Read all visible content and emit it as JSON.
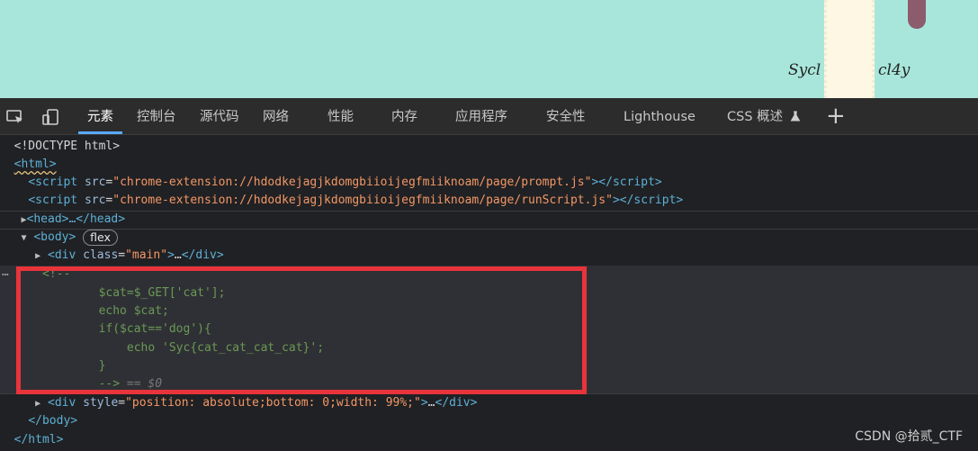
{
  "page": {
    "brand_left": "Sycl",
    "brand_right": "cl4y"
  },
  "devtools": {
    "tool_icons": [
      "inspect-element-icon",
      "device-toolbar-icon"
    ],
    "tabs": [
      {
        "label": "元素",
        "active": true
      },
      {
        "label": "控制台"
      },
      {
        "label": "源代码"
      },
      {
        "label": "网络"
      },
      {
        "label": "性能"
      },
      {
        "label": "内存"
      },
      {
        "label": "应用程序"
      },
      {
        "label": "安全性"
      },
      {
        "label": "Lighthouse"
      },
      {
        "label": "CSS 概述"
      }
    ],
    "css_overview_icon": "flask-icon",
    "add_tab": "+"
  },
  "dom": {
    "doctype": "<!DOCTYPE html>",
    "html_open": "<html>",
    "script1_tag": "script",
    "script1_attr": "src",
    "script1_value": "\"chrome-extension://hdodkejagjkdomgbiioijegfmiiknoam/page/prompt.js\"",
    "script2_value": "\"chrome-extension://hdodkejagjkdomgbiioijegfmiiknoam/page/runScript.js\"",
    "head": "<head>…</head>",
    "body_open": "<body>",
    "flex_badge": "flex",
    "div_main_class": "\"main\"",
    "ellipsis": "…",
    "comment_open": "<!--",
    "comment_lines": [
      "$cat=$_GET['cat'];",
      "echo $cat;",
      "if($cat=='dog'){",
      "echo 'Syc{cat_cat_cat_cat}';",
      "}"
    ],
    "comment_close": "-->",
    "comment_marker": " == $0",
    "div_style_value": "\"position: absolute;bottom: 0;width: 99%;\"",
    "body_close": "</body>",
    "html_close": "</html>",
    "row_dots": "⋯"
  },
  "watermark": "CSDN @拾贰_CTF",
  "colors": {
    "page_bg": "#a8e6db",
    "devtools_bg": "#202124",
    "highlight_box": "#e8343a",
    "active_tab_underline": "#5aa9ff"
  }
}
